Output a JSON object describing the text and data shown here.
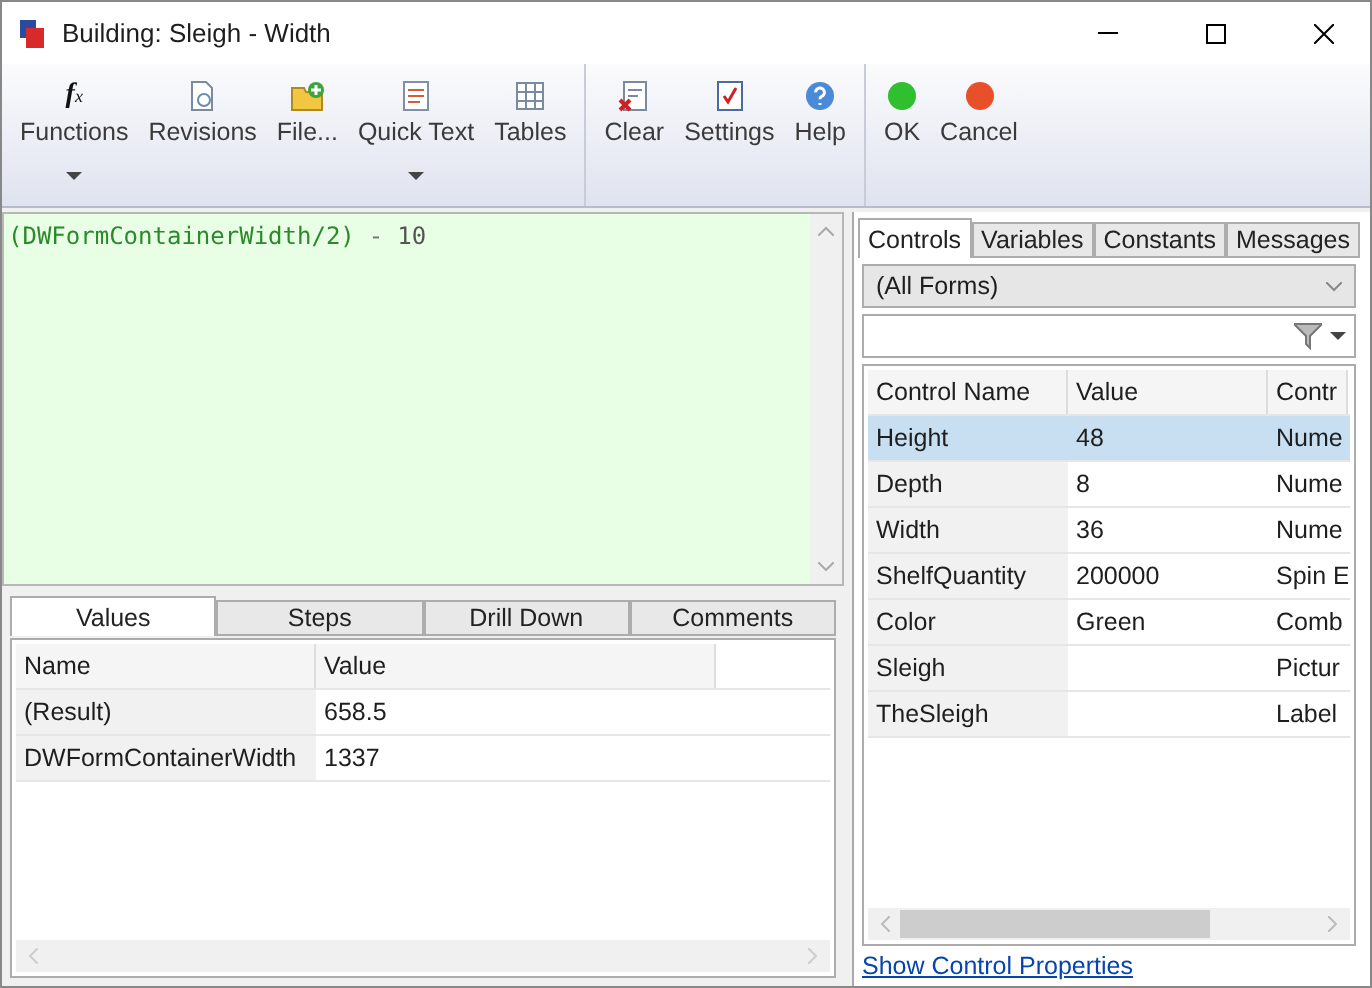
{
  "window": {
    "title": "Building: Sleigh - Width"
  },
  "toolbar": {
    "groups": [
      [
        {
          "label": "Functions",
          "icon_text": [
            "f",
            "x"
          ],
          "dropdown": true
        },
        {
          "label": "Revisions",
          "dropdown": false
        },
        {
          "label": "File...",
          "dropdown": false
        },
        {
          "label": "Quick Text",
          "dropdown": true
        },
        {
          "label": "Tables",
          "dropdown": false
        }
      ],
      [
        {
          "label": "Clear",
          "dropdown": false
        },
        {
          "label": "Settings",
          "dropdown": false
        },
        {
          "label": "Help",
          "dropdown": false
        }
      ],
      [
        {
          "label": "OK",
          "dropdown": false
        },
        {
          "label": "Cancel",
          "dropdown": false
        }
      ]
    ]
  },
  "formula": [
    {
      "text": "(DWFormContainerWidth/2)",
      "kind": "reference"
    },
    {
      "text": "-",
      "kind": "operator"
    },
    {
      "text": "10",
      "kind": "number"
    }
  ],
  "result_tabs": [
    {
      "label": "Values",
      "selected": true
    },
    {
      "label": "Steps",
      "selected": false
    },
    {
      "label": "Drill Down",
      "selected": false
    },
    {
      "label": "Comments",
      "selected": false
    }
  ],
  "values_table": {
    "columns": [
      "Name",
      "Value"
    ],
    "rows": [
      {
        "name": "(Result)",
        "value": "658.5"
      },
      {
        "name": "DWFormContainerWidth",
        "value": "1337"
      }
    ]
  },
  "side_tabs": [
    {
      "label": "Controls",
      "selected": true
    },
    {
      "label": "Variables",
      "selected": false
    },
    {
      "label": "Constants",
      "selected": false
    },
    {
      "label": "Messages",
      "selected": false
    }
  ],
  "form_select": {
    "value": "(All Forms)"
  },
  "controls_table": {
    "columns": [
      "Control Name",
      "Value",
      "Contr"
    ],
    "rows": [
      {
        "cells": [
          "Height",
          "48",
          "Nume"
        ],
        "selected": true
      },
      {
        "cells": [
          "Depth",
          "8",
          "Nume"
        ],
        "selected": false
      },
      {
        "cells": [
          "Width",
          "36",
          "Nume"
        ],
        "selected": false
      },
      {
        "cells": [
          "ShelfQuantity",
          "200000",
          "Spin E"
        ],
        "selected": false
      },
      {
        "cells": [
          "Color",
          "Green",
          "Comb"
        ],
        "selected": false
      },
      {
        "cells": [
          "Sleigh",
          "",
          "Pictur"
        ],
        "selected": false
      },
      {
        "cells": [
          "TheSleigh",
          "",
          "Label"
        ],
        "selected": false
      }
    ]
  },
  "link": "Show Control Properties"
}
